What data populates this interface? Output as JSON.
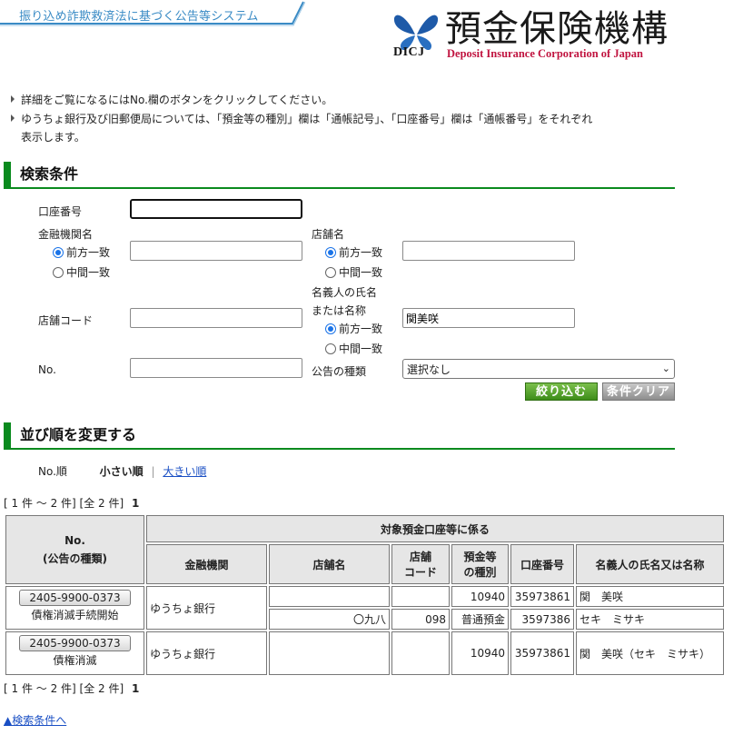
{
  "header": {
    "system_title": "振り込め詐欺救済法に基づく公告等システム",
    "logo_jp": "預金保険機構",
    "logo_en": "Deposit Insurance Corporation of Japan",
    "logo_abbr": "DICJ"
  },
  "notes": [
    "詳細をご覧になるにはNo.欄のボタンをクリックしてください。",
    "ゆうちょ銀行及び旧郵便局については、「預金等の種別」欄は「通帳記号」、「口座番号」欄は「通帳番号」をそれぞれ",
    "表示します。"
  ],
  "search": {
    "heading": "検索条件",
    "account_label": "口座番号",
    "account_value": "",
    "bank_label": "金融機関名",
    "bank_value": "",
    "branch_label": "店舗名",
    "branch_value": "",
    "prefix_label": "前方一致",
    "partial_label": "中間一致",
    "holder_label_1": "名義人の氏名",
    "holder_label_2": "または名称",
    "holder_value": "関美咲",
    "branch_code_label": "店舗コード",
    "branch_code_value": "",
    "no_label": "No.",
    "no_value": "",
    "notice_type_label": "公告の種類",
    "notice_type_selected": "選択なし",
    "filter_button": "絞り込む",
    "clear_button": "条件クリア"
  },
  "sort": {
    "heading": "並び順を変更する",
    "field": "No.順",
    "asc": "小さい順",
    "separator": "|",
    "desc": "大きい順"
  },
  "pagination": {
    "range": "[ 1 件 ～ 2 件]",
    "total": "[全 2 件]",
    "page": "1"
  },
  "table": {
    "col_no": "No.",
    "col_no_sub": "(公告の種類)",
    "group_header": "対象預金口座等に係る",
    "col_bank": "金融機関",
    "col_branch": "店舗名",
    "col_branch_code_1": "店舗",
    "col_branch_code_2": "コード",
    "col_type_1": "預金等",
    "col_type_2": "の種別",
    "col_account": "口座番号",
    "col_holder": "名義人の氏名又は名称",
    "rows": [
      {
        "no": "2405-9900-0373",
        "notice_type": "債権消滅手続開始",
        "bank": "ゆうちょ銀行",
        "lines": [
          {
            "branch": "",
            "branch_code": "",
            "type": "10940",
            "account": "35973861",
            "holder": "関　美咲"
          },
          {
            "branch": "〇九八",
            "branch_code": "098",
            "type": "普通預金",
            "account": "3597386",
            "holder": "セキ　ミサキ"
          }
        ]
      },
      {
        "no": "2405-9900-0373",
        "notice_type": "債権消滅",
        "bank": "ゆうちょ銀行",
        "lines": [
          {
            "branch": "",
            "branch_code": "",
            "type": "10940",
            "account": "35973861",
            "holder": "関　美咲（セキ　ミサキ）"
          }
        ]
      }
    ]
  },
  "footer": {
    "back_link": "▲検索条件へ"
  }
}
